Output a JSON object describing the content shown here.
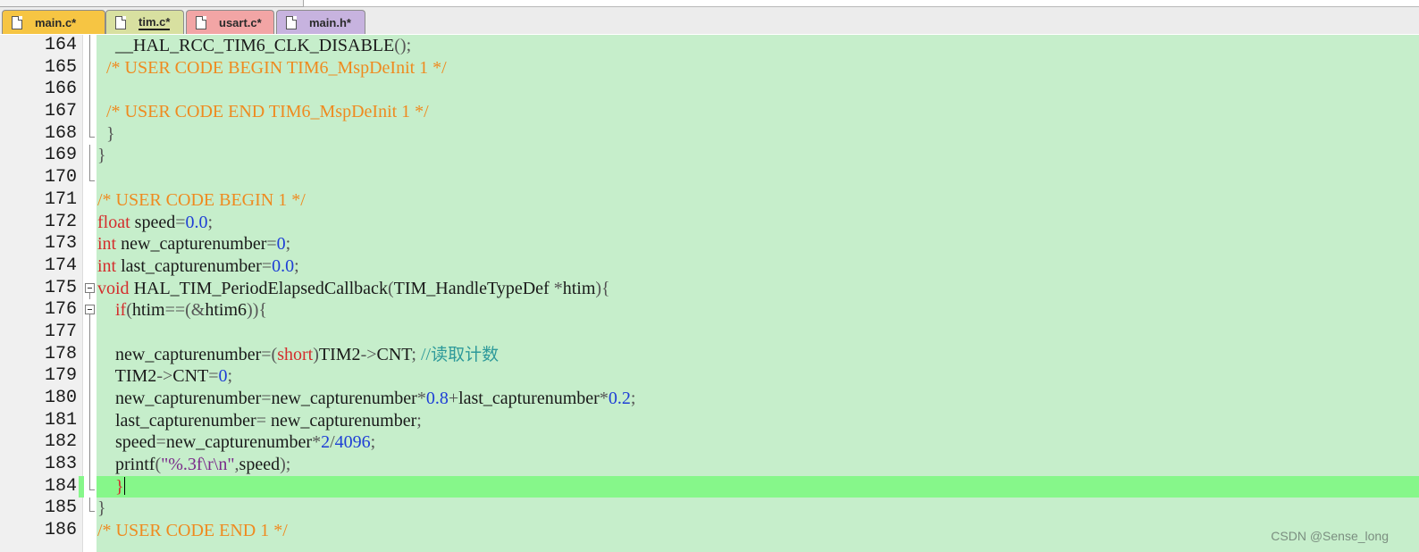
{
  "tabs": [
    {
      "label": "main.c*",
      "color": "#f6c543",
      "active": false
    },
    {
      "label": "tim.c*",
      "color": "#d8e0a0",
      "active": true
    },
    {
      "label": "usart.c*",
      "color": "#f2a5a5",
      "active": false
    },
    {
      "label": "main.h*",
      "color": "#c7b3df",
      "active": false
    }
  ],
  "editor": {
    "background": "#c6eecb",
    "current_line_highlight": "#86f78a",
    "current_line": 184,
    "line_numbers": [
      "164",
      "165",
      "166",
      "167",
      "168",
      "169",
      "170",
      "171",
      "172",
      "173",
      "174",
      "175",
      "176",
      "177",
      "178",
      "179",
      "180",
      "181",
      "182",
      "183",
      "184",
      "185",
      "186"
    ],
    "lines": [
      "    __HAL_RCC_TIM6_CLK_DISABLE();",
      "  /* USER CODE BEGIN TIM6_MspDeInit 1 */",
      "",
      "  /* USER CODE END TIM6_MspDeInit 1 */",
      "  }",
      "}",
      "",
      "/* USER CODE BEGIN 1 */",
      "float speed=0.0;",
      "int new_capturenumber=0;",
      "int last_capturenumber=0.0;",
      "void HAL_TIM_PeriodElapsedCallback(TIM_HandleTypeDef *htim){",
      "    if(htim==(&htim6)){",
      "",
      "    new_capturenumber=(short)TIM2->CNT; //读取计数",
      "    TIM2->CNT=0;",
      "    new_capturenumber=new_capturenumber*0.8+last_capturenumber*0.2;",
      "    last_capturenumber= new_capturenumber;",
      "    speed=new_capturenumber*2/4096;",
      "    printf(\"%.3f\\r\\n\",speed);",
      "    }",
      "}",
      "/* USER CODE END 1 */"
    ]
  },
  "watermark": "CSDN @Sense_long"
}
